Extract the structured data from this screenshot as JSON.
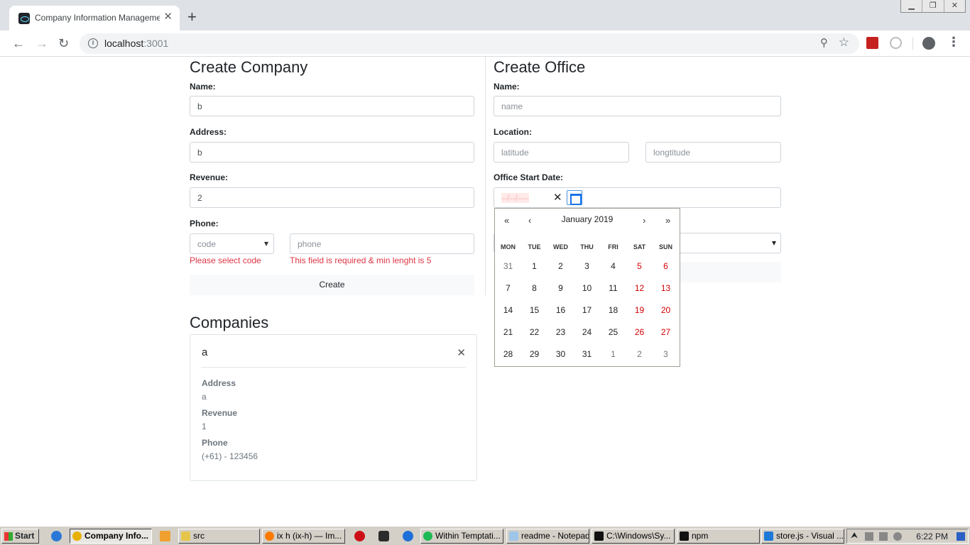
{
  "browser": {
    "tab_title": "Company Information Management",
    "tab_close": "✕",
    "new_tab": "+",
    "url_host": "localhost",
    "url_port": ":3001",
    "window_controls": [
      "▁",
      "❐",
      "✕"
    ]
  },
  "create_company": {
    "title": "Create Company",
    "name_label": "Name:",
    "name_value": "b",
    "address_label": "Address:",
    "address_value": "b",
    "revenue_label": "Revenue:",
    "revenue_value": "2",
    "phone_label": "Phone:",
    "code_select": "code",
    "phone_placeholder": "phone",
    "code_error": "Please select code",
    "phone_error": "This field is required & min lenght is 5",
    "create_button": "Create"
  },
  "create_office": {
    "title": "Create Office",
    "name_label": "Name:",
    "name_placeholder": "name",
    "location_label": "Location:",
    "latitude_placeholder": "latitude",
    "longitude_placeholder": "longtitude",
    "start_date_label": "Office Start Date:",
    "date_value": "--/--/----",
    "clear_icon": "✕"
  },
  "calendar": {
    "prev_year": "«",
    "prev_month": "‹",
    "next_month": "›",
    "next_year": "»",
    "month_label": "January 2019",
    "weekdays": [
      "MON",
      "TUE",
      "WED",
      "THU",
      "FRI",
      "SAT",
      "SUN"
    ],
    "weeks": [
      [
        "31",
        "1",
        "2",
        "3",
        "4",
        "5",
        "6"
      ],
      [
        "7",
        "8",
        "9",
        "10",
        "11",
        "12",
        "13"
      ],
      [
        "14",
        "15",
        "16",
        "17",
        "18",
        "19",
        "20"
      ],
      [
        "21",
        "22",
        "23",
        "24",
        "25",
        "26",
        "27"
      ],
      [
        "28",
        "29",
        "30",
        "31",
        "1",
        "2",
        "3"
      ]
    ],
    "colors": {
      "weekend": "#d10000",
      "other_month": "#757575"
    }
  },
  "companies": {
    "title": "Companies",
    "card": {
      "name": "a",
      "close_icon": "✕",
      "address_label": "Address",
      "address_value": "a",
      "revenue_label": "Revenue",
      "revenue_value": "1",
      "phone_label": "Phone",
      "phone_value": "(+61) - 123456"
    }
  },
  "taskbar": {
    "start": "Start",
    "items": [
      "Company Info...",
      "src",
      "ix h (ix-h) — Im...",
      "Within Temptati...",
      "readme - Notepad",
      "C:\\Windows\\Sy...",
      "npm",
      "store.js - Visual ..."
    ],
    "tray_expand": "⮝",
    "time": "6:22 PM"
  }
}
